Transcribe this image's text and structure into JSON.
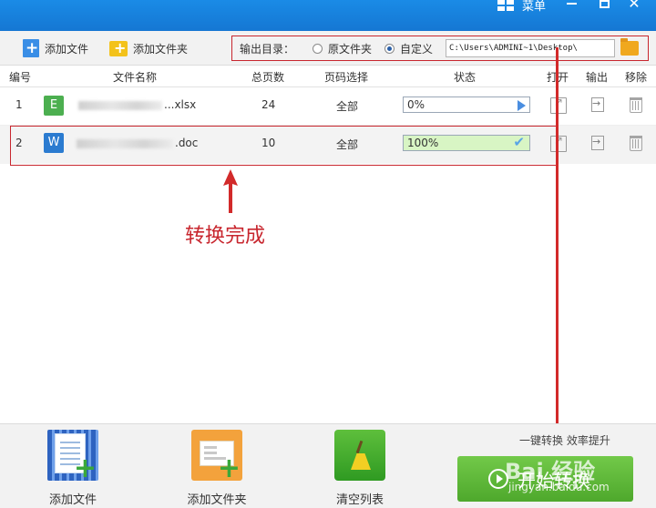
{
  "window": {
    "title": "菜单"
  },
  "toolbar": {
    "add_file_label": "添加文件",
    "add_folder_label": "添加文件夹",
    "output": {
      "label": "输出目录：",
      "option_original": "原文件夹",
      "option_custom": "自定义",
      "selected": "custom",
      "path": "C:\\Users\\ADMINI~1\\Desktop\\"
    }
  },
  "columns": {
    "index": "编号",
    "name": "文件名称",
    "pages": "总页数",
    "page_select": "页码选择",
    "status": "状态",
    "open": "打开",
    "export": "输出",
    "remove": "移除"
  },
  "rows": [
    {
      "index": "1",
      "type": "E",
      "name_suffix": "...xlsx",
      "pages": "24",
      "page_select": "全部",
      "progress_text": "0%",
      "progress": 0
    },
    {
      "index": "2",
      "type": "W",
      "name_suffix": ".doc",
      "pages": "10",
      "page_select": "全部",
      "progress_text": "100%",
      "progress": 1
    }
  ],
  "annotation": {
    "text": "转换完成",
    "color": "#c8262e"
  },
  "bottom": {
    "add_file_label": "添加文件",
    "add_folder_label": "添加文件夹",
    "clear_label": "清空列表",
    "tip": "一键转换 效率提升",
    "start_label": "开始转换"
  },
  "watermark": {
    "brand": "Bai 经验",
    "url": "jingyan.baidu.com"
  },
  "colors": {
    "titlebar": "#1577d3",
    "accent_green": "#5cb535",
    "annotation_red": "#c8262e"
  }
}
